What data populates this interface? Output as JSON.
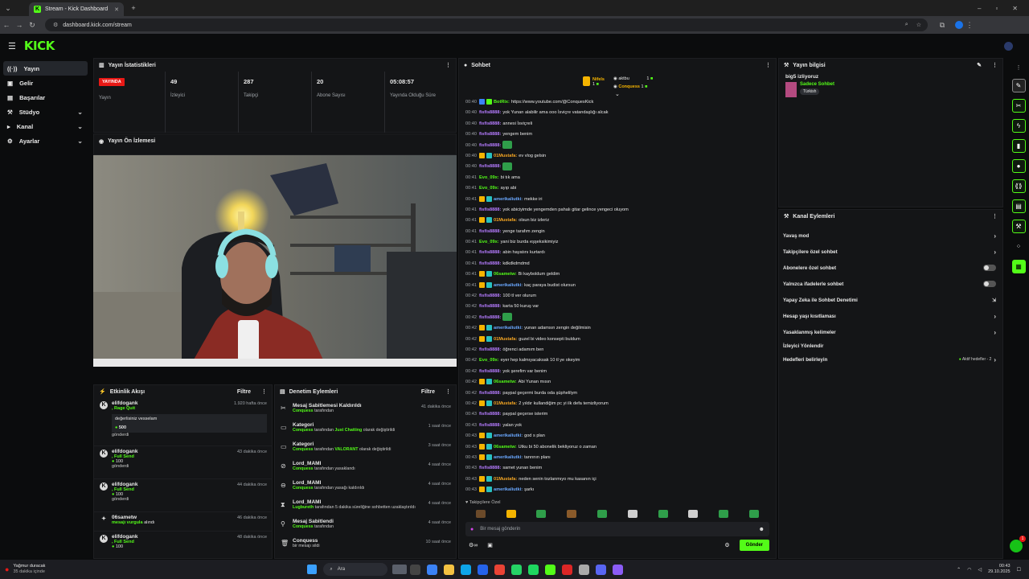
{
  "browser": {
    "tab_title": "Stream - Kick Dashboard",
    "url": "dashboard.kick.com/stream"
  },
  "app": {
    "logo": "KICK"
  },
  "sidebar": {
    "items": [
      {
        "label": "Yayın",
        "icon": "broadcast-icon"
      },
      {
        "label": "Gelir",
        "icon": "money-icon"
      },
      {
        "label": "Başarılar",
        "icon": "trophy-icon"
      },
      {
        "label": "Stüdyo",
        "icon": "studio-icon"
      },
      {
        "label": "Kanal",
        "icon": "channel-icon"
      },
      {
        "label": "Ayarlar",
        "icon": "gear-icon"
      }
    ]
  },
  "stats": {
    "title": "Yayın İstatistikleri",
    "live_badge": "YAYINDA",
    "cells": [
      {
        "value": "",
        "label": "Yayın"
      },
      {
        "value": "49",
        "label": "İzleyici"
      },
      {
        "value": "287",
        "label": "Takipçi"
      },
      {
        "value": "20",
        "label": "Abone Sayısı"
      },
      {
        "value": "05:08:57",
        "label": "Yayında Olduğu Süre"
      }
    ]
  },
  "preview": {
    "title": "Yayın Ön İzlemesi"
  },
  "activity": {
    "title": "Etkinlik Akışı",
    "filter": "Filtre",
    "items": [
      {
        "name": "elifdogank",
        "sub": ", Rage Quit",
        "time": "1.920 hafta önce",
        "message": "değerlisiniz vesselam",
        "amount": "500",
        "note": "gönderdi"
      },
      {
        "name": "elifdogank",
        "sub": ", Full Send",
        "time": "43 dakika önce",
        "amount": "100",
        "note": "gönderdi"
      },
      {
        "name": "elifdogank",
        "sub": ", Full Send",
        "time": "44 dakika önce",
        "amount": "100",
        "note": "gönderdi"
      },
      {
        "name": "06sametw",
        "sub": "mesajı vurgula",
        "sub2": "alındı",
        "time": "46 dakika önce"
      },
      {
        "name": "elifdogank",
        "sub": ", Full Send",
        "time": "48 dakika önce",
        "amount": "100"
      }
    ]
  },
  "moderation": {
    "title": "Denetim Eylemleri",
    "filter": "Filtre",
    "items": [
      {
        "title": "Mesaj Sabitlemesi Kaldırıldı",
        "actor": "Conquess",
        "rest": " tarafından",
        "time": "41 dakika önce",
        "icon": "pin-off-icon"
      },
      {
        "title": "Kategori",
        "actor": "Conquess",
        "rest": " tarafından ",
        "actor2": "Just Chatting",
        "rest2": " olarak değiştirildi",
        "time": "1 saat önce",
        "icon": "category-icon"
      },
      {
        "title": "Kategori",
        "actor": "Conquess",
        "rest": " tarafından ",
        "actor2": "VALORANT",
        "rest2": " olarak değiştirildi",
        "time": "3 saat önce",
        "icon": "category-icon"
      },
      {
        "title": "Lord_MAMI",
        "actor": "Conquess",
        "rest": " tarafından yasaklandı",
        "time": "4 saat önce",
        "icon": "ban-icon"
      },
      {
        "title": "Lord_MAMI",
        "actor": "Conquess",
        "rest": " tarafından yasağı kaldırıldı",
        "time": "4 saat önce",
        "icon": "unban-icon"
      },
      {
        "title": "Lord_MAMI",
        "actor": "Lugbureth",
        "rest": " tarafından 5 dakika süreliğine sohbetten uzaklaştırıldı",
        "time": "4 saat önce",
        "icon": "hourglass-icon"
      },
      {
        "title": "Mesaj Sabitlendi",
        "actor": "Conquess",
        "rest": " tarafından",
        "time": "4 saat önce",
        "icon": "pin-icon"
      },
      {
        "title": "Conquess",
        "actor": "",
        "rest": "bir mesajı sildi",
        "time": "10 saat önce",
        "icon": "trash-icon"
      }
    ]
  },
  "chat": {
    "title": "Sohbet",
    "leaders": [
      {
        "name": "Nifels",
        "count": "1",
        "color": "#f5b400"
      },
      {
        "name": "aktbu",
        "count": "1",
        "color": "#ffffff"
      },
      {
        "name": "Conquess",
        "count": "1",
        "color": "#f5b400"
      }
    ],
    "messages": [
      {
        "t": "00:40",
        "n": "BotRix:",
        "m": "https://www.youtube.com/@ConquesKick",
        "c": "#53fc18",
        "b": "blue"
      },
      {
        "t": "00:40",
        "n": "fisfis8888:",
        "m": "yok Yunan alabilir ama ooo İsviçre vatandaşlığı alcak",
        "c": "#b57bff",
        "b": ""
      },
      {
        "t": "00:40",
        "n": "fisfis8888:",
        "m": "annesi İsviçreli",
        "c": "#b57bff",
        "b": ""
      },
      {
        "t": "00:40",
        "n": "fisfis8888:",
        "m": "yengem benim",
        "c": "#b57bff",
        "b": ""
      },
      {
        "t": "00:40",
        "n": "fisfis8888:",
        "m": "",
        "c": "#b57bff",
        "b": "",
        "emote": true
      },
      {
        "t": "00:40",
        "n": "01Mustafa:",
        "m": "ev vlog gelsin",
        "c": "#f5a623",
        "b": "gold"
      },
      {
        "t": "00:40",
        "n": "fisfis8888:",
        "m": "",
        "c": "#b57bff",
        "b": "",
        "emote": true
      },
      {
        "t": "00:41",
        "n": "Evo_09x:",
        "m": "bi tık ama",
        "c": "#53fc18",
        "b": ""
      },
      {
        "t": "00:41",
        "n": "Evo_09x:",
        "m": "ayıp abi",
        "c": "#53fc18",
        "b": ""
      },
      {
        "t": "00:41",
        "n": "amerikaliutki:",
        "m": "mekke iri",
        "c": "#6aa8ff",
        "b": "gold"
      },
      {
        "t": "00:41",
        "n": "fisfis8888:",
        "m": "yok abiciyimde yengemden pahalı gitar gelince yengeci oluyom",
        "c": "#b57bff",
        "b": ""
      },
      {
        "t": "00:41",
        "n": "01Mustafa:",
        "m": "olsun biz izleriz",
        "c": "#f5a623",
        "b": "gold"
      },
      {
        "t": "00:41",
        "n": "fisfis8888:",
        "m": "yenge tarafım zengin",
        "c": "#b57bff",
        "b": ""
      },
      {
        "t": "00:41",
        "n": "Evo_09x:",
        "m": "yani biz burda eşşeksikimiyiz",
        "c": "#53fc18",
        "b": ""
      },
      {
        "t": "00:41",
        "n": "fisfis8888:",
        "m": "abin hayatını kurtardı",
        "c": "#b57bff",
        "b": ""
      },
      {
        "t": "00:41",
        "n": "fisfis8888:",
        "m": "kdkdkdmdmd",
        "c": "#b57bff",
        "b": ""
      },
      {
        "t": "00:41",
        "n": "06sametw:",
        "m": "Bi kayboldum geldim",
        "c": "#53fc18",
        "b": "gold"
      },
      {
        "t": "00:41",
        "n": "amerikaliutki:",
        "m": "kaç paraya budist olursun",
        "c": "#6aa8ff",
        "b": "gold"
      },
      {
        "t": "00:42",
        "n": "fisfis8888:",
        "m": "100 tl ver olurum",
        "c": "#b57bff",
        "b": ""
      },
      {
        "t": "00:42",
        "n": "fisfis8888:",
        "m": "karta 50 kuruş var",
        "c": "#b57bff",
        "b": ""
      },
      {
        "t": "00:42",
        "n": "fisfis8888:",
        "m": "",
        "c": "#b57bff",
        "b": "",
        "emote": true
      },
      {
        "t": "00:42",
        "n": "amerikaliutki:",
        "m": "yunan adamsın zengin değilmisin",
        "c": "#6aa8ff",
        "b": "gold"
      },
      {
        "t": "00:42",
        "n": "01Mustafa:",
        "m": "guzel bi video konsepti buldum",
        "c": "#f5a623",
        "b": "gold"
      },
      {
        "t": "00:42",
        "n": "fisfis8888:",
        "m": "öğrenci adamım ben",
        "c": "#b57bff",
        "b": ""
      },
      {
        "t": "00:42",
        "n": "Evo_09x:",
        "m": "eyer hep kalmıyacaksak 10 tl ye okeyim",
        "c": "#53fc18",
        "b": ""
      },
      {
        "t": "00:42",
        "n": "fisfis8888:",
        "m": "yok şerefim var benim",
        "c": "#b57bff",
        "b": ""
      },
      {
        "t": "00:42",
        "n": "06sametw:",
        "m": "Abi Yunan mısın",
        "c": "#53fc18",
        "b": "gold"
      },
      {
        "t": "00:42",
        "n": "fisfis8888:",
        "m": "paypal geçermi burda oda şüphelilym",
        "c": "#b57bff",
        "b": ""
      },
      {
        "t": "00:42",
        "n": "01Mustafa:",
        "m": "2 yıldır kullandiğim pc yi ilk defa temizliyorum",
        "c": "#f5a623",
        "b": "gold"
      },
      {
        "t": "00:43",
        "n": "fisfis8888:",
        "m": "paypal geçerse isterim",
        "c": "#b57bff",
        "b": ""
      },
      {
        "t": "00:43",
        "n": "fisfis8888:",
        "m": "yalan yok",
        "c": "#b57bff",
        "b": ""
      },
      {
        "t": "00:43",
        "n": "amerikaliutki:",
        "m": "god s plan",
        "c": "#6aa8ff",
        "b": "gold"
      },
      {
        "t": "00:43",
        "n": "06sametw:",
        "m": "Utku bi 50 abonelik bekliyoruz o zaman",
        "c": "#53fc18",
        "b": "gold"
      },
      {
        "t": "00:43",
        "n": "amerikaliutki:",
        "m": "tanrının planı",
        "c": "#6aa8ff",
        "b": "gold"
      },
      {
        "t": "00:43",
        "n": "fisfis8888:",
        "m": "samet yunan benim",
        "c": "#b57bff",
        "b": ""
      },
      {
        "t": "00:43",
        "n": "01Mustafa:",
        "m": "neden senin tozlanmıyo mu kasanın içi",
        "c": "#f5a623",
        "b": "gold"
      },
      {
        "t": "00:43",
        "n": "amerikaliutki:",
        "m": "şarkı",
        "c": "#6aa8ff",
        "b": "gold"
      }
    ],
    "followers_only": "Takipçilere Özel",
    "input_placeholder": "Bir mesaj gönderin",
    "send_label": "Gönder"
  },
  "stream_info": {
    "title": "Yayın bilgisi",
    "stream_title": "big5 izliyoruz",
    "category": "Sadece Sohbet",
    "tag": "Türkish"
  },
  "channel_actions": {
    "title": "Kanal Eylemleri",
    "rows": [
      {
        "label": "Yavaş mod",
        "ctrl": "chevron"
      },
      {
        "label": "Takipçilere özel sohbet",
        "ctrl": "chevron"
      },
      {
        "label": "Abonelere özel sohbet",
        "ctrl": "toggle"
      },
      {
        "label": "Yalnızca ifadelerle sohbet",
        "ctrl": "toggle"
      },
      {
        "label": "Yapay Zeka ile Sohbet Denetimi",
        "ctrl": "ext"
      },
      {
        "label": "Hesap yaşı kısıtlaması",
        "ctrl": "chevron"
      },
      {
        "label": "Yasaklanmış kelimeler",
        "ctrl": "chevron"
      },
      {
        "label": "İzleyici Yönlendir",
        "ctrl": "none"
      },
      {
        "label": "Hedefleri belirleyin",
        "ctrl": "chevron",
        "extra": "Aktif hedefler - 2"
      }
    ]
  },
  "taskbar": {
    "weather_title": "Yağmur duracak",
    "weather_sub": "35 dakika içinde",
    "search": "Ara",
    "time": "00:43",
    "date": "29.10.2025",
    "notification_count": "1"
  }
}
